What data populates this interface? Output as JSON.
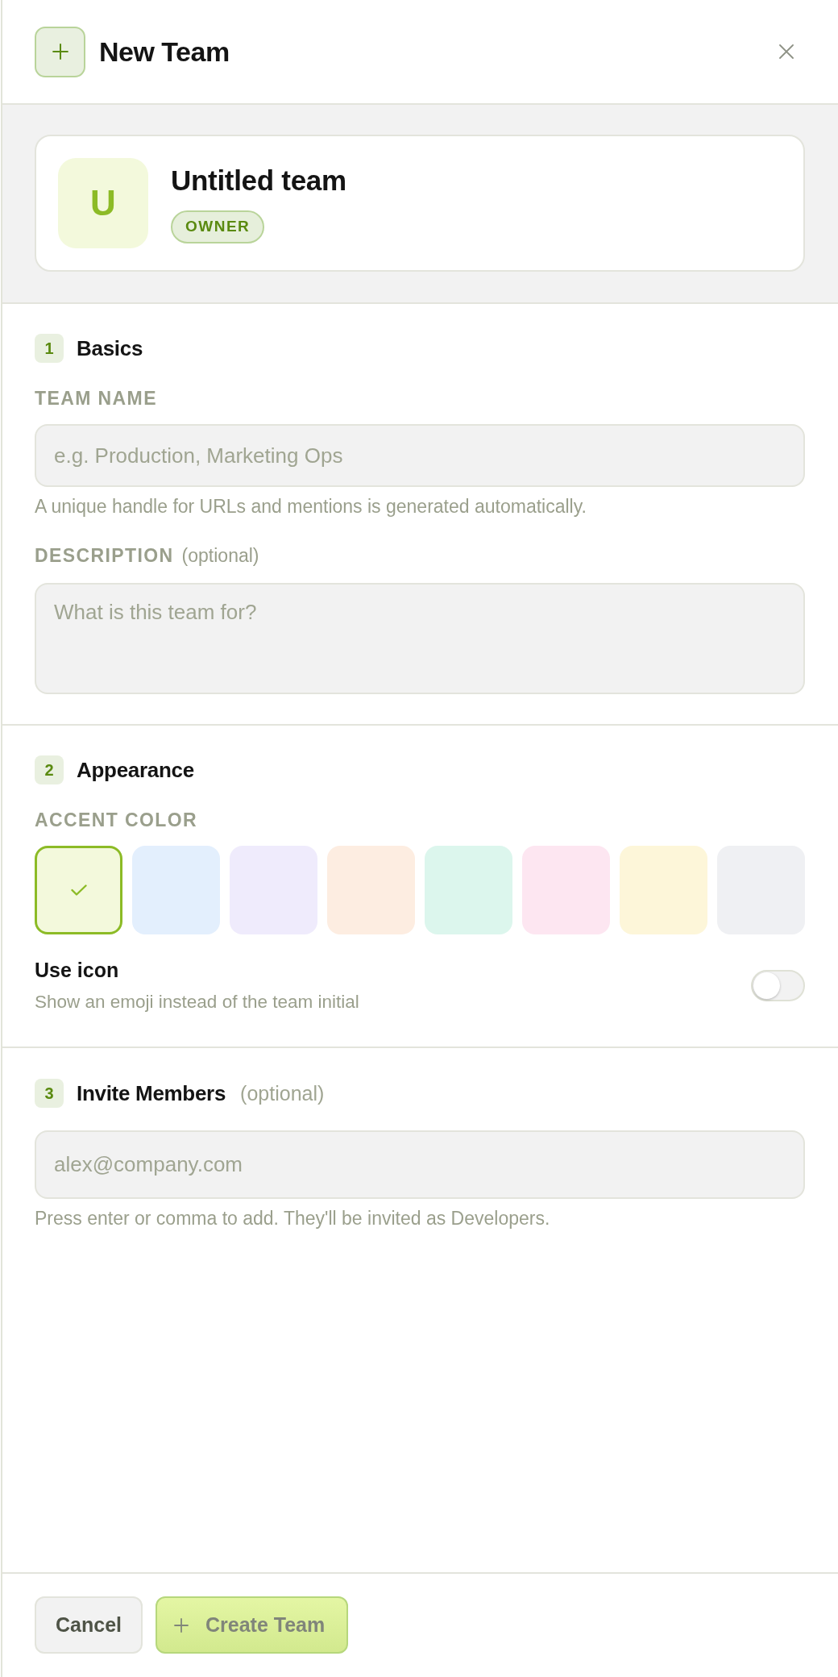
{
  "header": {
    "title": "New Team"
  },
  "preview": {
    "initial": "U",
    "name": "Untitled team",
    "role": "OWNER"
  },
  "basics": {
    "number": "1",
    "title": "Basics",
    "team_name": {
      "label": "TEAM NAME",
      "placeholder": "e.g. Production, Marketing Ops",
      "hint": "A unique handle for URLs and mentions is generated automatically."
    },
    "description": {
      "label": "DESCRIPTION",
      "note": "(optional)",
      "placeholder": "What is this team for?"
    }
  },
  "appearance": {
    "number": "2",
    "title": "Appearance",
    "accent_label": "ACCENT COLOR",
    "accent_colors": [
      {
        "color": "#f3f9dc",
        "selected": true
      },
      {
        "color": "#e3effd",
        "selected": false
      },
      {
        "color": "#efebfc",
        "selected": false
      },
      {
        "color": "#fdede1",
        "selected": false
      },
      {
        "color": "#dcf6ed",
        "selected": false
      },
      {
        "color": "#fde6f1",
        "selected": false
      },
      {
        "color": "#fdf6d9",
        "selected": false
      },
      {
        "color": "#eff0f3",
        "selected": false
      }
    ],
    "use_icon": {
      "label": "Use icon",
      "description": "Show an emoji instead of the team initial",
      "on": false
    }
  },
  "invite": {
    "number": "3",
    "title": "Invite Members",
    "note": "(optional)",
    "placeholder": "alex@company.com",
    "hint": "Press enter or comma to add. They'll be invited as Developers."
  },
  "footer": {
    "buttons": [
      {
        "label": "Cancel",
        "kind": "secondary",
        "disabled": false
      },
      {
        "label": "Create Team",
        "kind": "primary",
        "disabled": true
      }
    ]
  }
}
